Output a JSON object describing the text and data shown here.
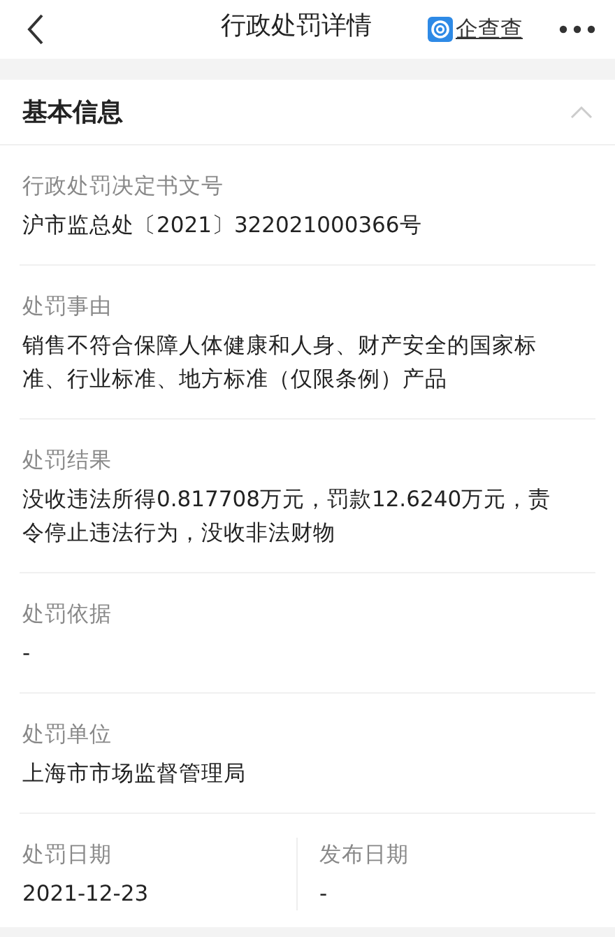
{
  "header": {
    "title": "行政处罚详情",
    "brand": "企查查"
  },
  "section": {
    "title": "基本信息",
    "expanded": true,
    "fields": [
      {
        "kind": "full",
        "label": "行政处罚决定书文号",
        "value": "沪市监总处〔2021〕322021000366号"
      },
      {
        "kind": "full",
        "label": "处罚事由",
        "value": "销售不符合保障人体健康和人身、财产安全的国家标准、行业标准、地方标准（仅限条例）产品"
      },
      {
        "kind": "full",
        "label": "处罚结果",
        "value": "没收违法所得0.817708万元，罚款12.6240万元，责令停止违法行为，没收非法财物"
      },
      {
        "kind": "full",
        "label": "处罚依据",
        "value": "-"
      },
      {
        "kind": "full",
        "label": "处罚单位",
        "value": "上海市市场监督管理局"
      },
      {
        "kind": "half",
        "label": "处罚日期",
        "value": "2021-12-23"
      },
      {
        "kind": "half",
        "label": "发布日期",
        "value": "-"
      }
    ]
  }
}
